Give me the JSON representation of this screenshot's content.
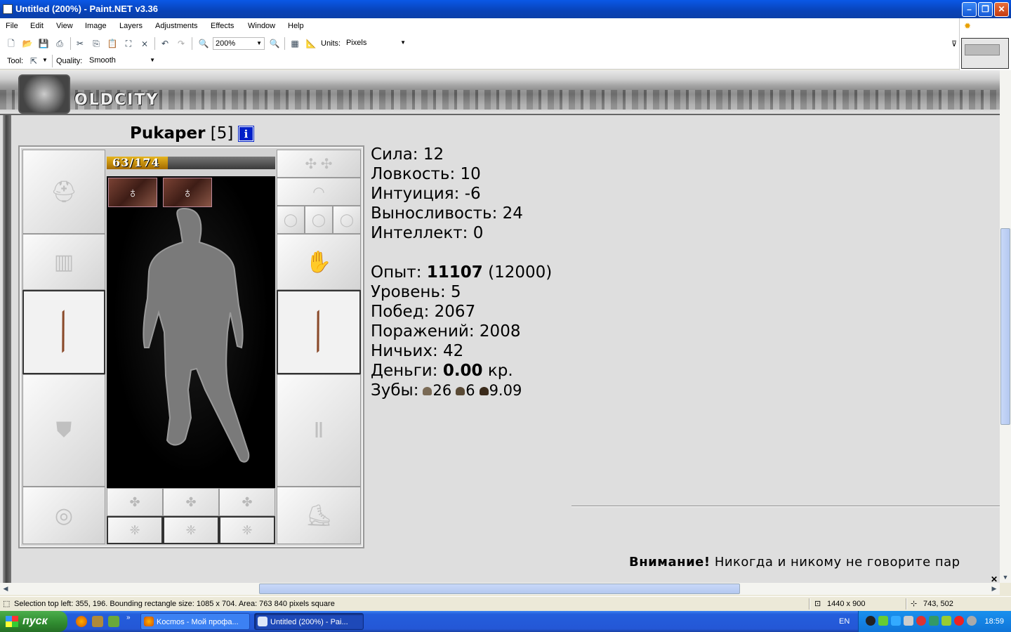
{
  "window": {
    "title": "Untitled (200%) - Paint.NET v3.36"
  },
  "menu": [
    "File",
    "Edit",
    "View",
    "Image",
    "Layers",
    "Adjustments",
    "Effects",
    "Window",
    "Help"
  ],
  "toolbar": {
    "zoom": "200%",
    "units_label": "Units:",
    "units_value": "Pixels"
  },
  "toolbar2": {
    "tool_label": "Tool:",
    "quality_label": "Quality:",
    "quality_value": "Smooth"
  },
  "game": {
    "logo": "OLDCITY",
    "char_name": "Pukaper",
    "char_level": "[5]",
    "info_glyph": "i",
    "hp": {
      "text": "63/174",
      "current": 63,
      "max": 174
    },
    "stats": {
      "strength": "Сила: 12",
      "agility": "Ловкость: 10",
      "intuition": "Интуиция: -6",
      "endurance": "Выносливость: 24",
      "intellect": "Интеллект: 0"
    },
    "exp_label": "Опыт:",
    "exp_value": "11107",
    "exp_next": "(12000)",
    "level": "Уровень: 5",
    "wins": "Побед: 2067",
    "losses": "Поражений: 2008",
    "draws": "Ничьих: 42",
    "money_label": "Деньги:",
    "money_value": "0.00",
    "money_unit": "кр.",
    "teeth_label": "Зубы:",
    "teeth": [
      "26",
      "6",
      "9.09"
    ],
    "warning_bold": "Внимание!",
    "warning_text": "Никогда и никому не говорите пар"
  },
  "status": {
    "selection": "Selection top left: 355, 196. Bounding rectangle size: 1085 x 704. Area: 763 840 pixels square",
    "image_size": "1440 x 900",
    "cursor": "743, 502"
  },
  "taskbar": {
    "start": "пуск",
    "tasks": [
      "Kocmos - Мой профа...",
      "Untitled (200%) - Pai..."
    ],
    "lang": "EN",
    "clock": "18:59"
  }
}
